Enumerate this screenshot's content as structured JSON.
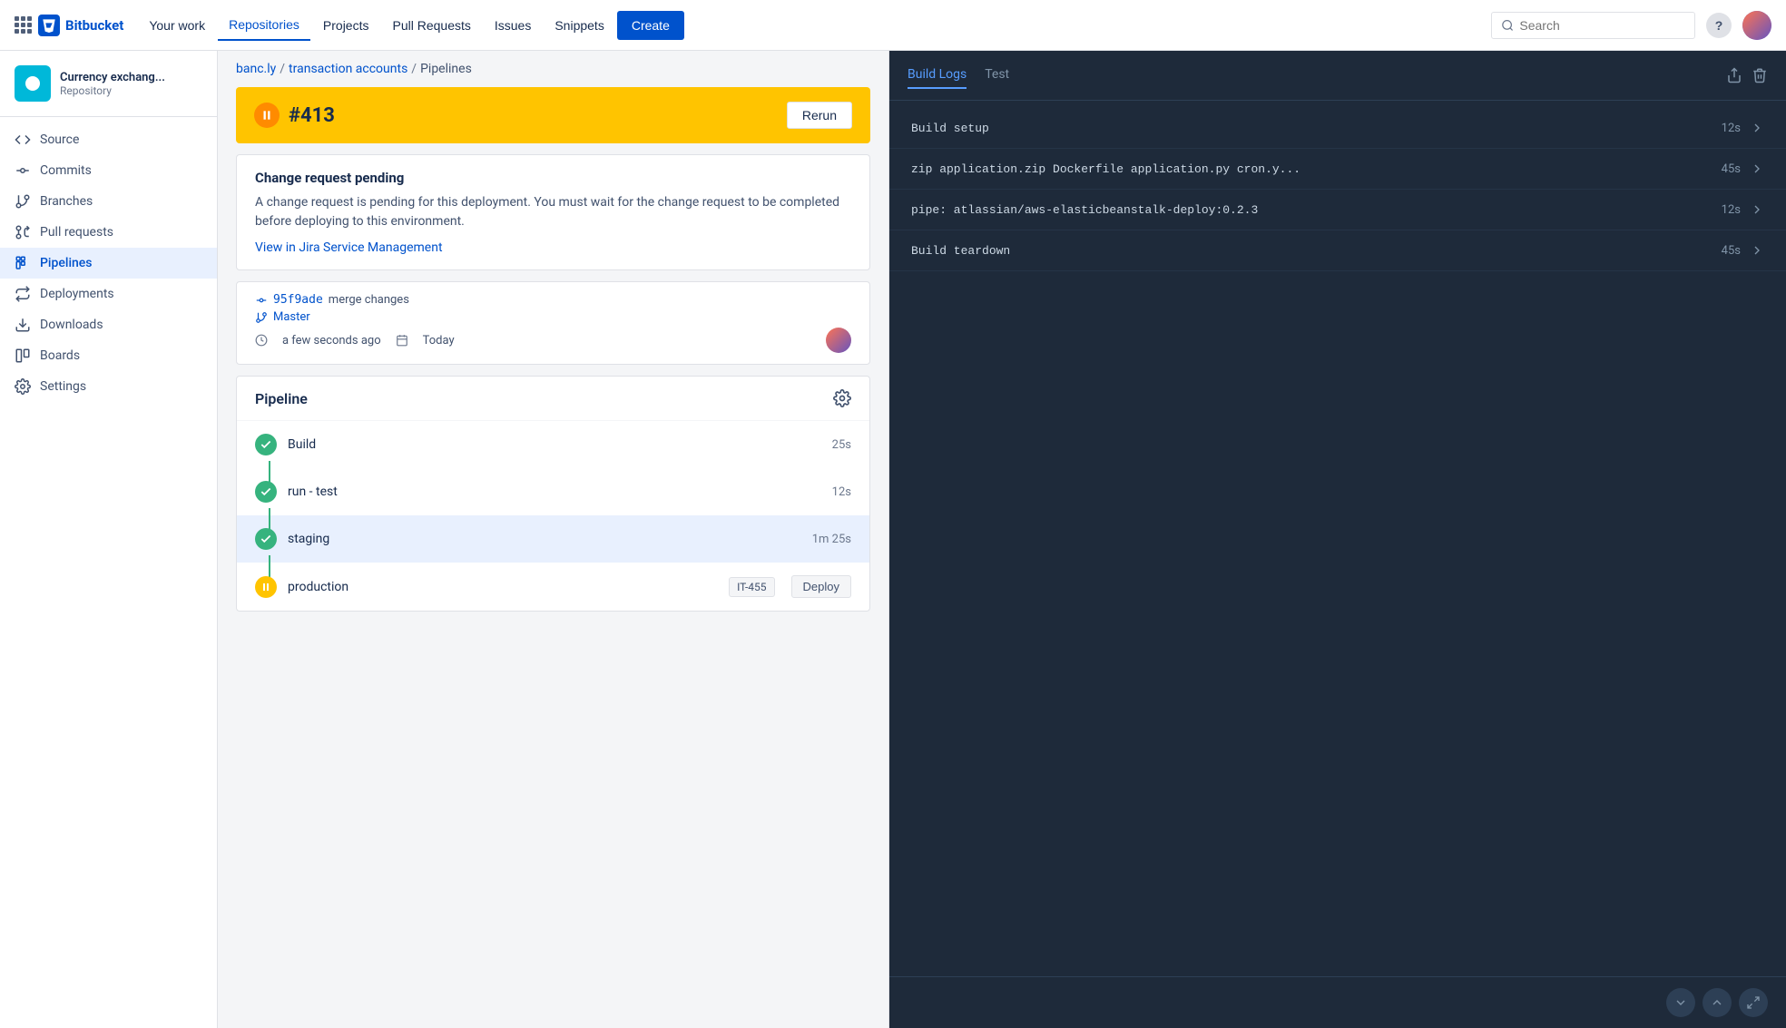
{
  "topnav": {
    "app_name": "Bitbucket",
    "links": [
      {
        "label": "Your work",
        "active": false
      },
      {
        "label": "Repositories",
        "active": true
      },
      {
        "label": "Projects",
        "active": false
      },
      {
        "label": "Pull Requests",
        "active": false
      },
      {
        "label": "Issues",
        "active": false
      },
      {
        "label": "Snippets",
        "active": false
      }
    ],
    "create_label": "Create",
    "search_placeholder": "Search",
    "help_label": "?"
  },
  "sidebar": {
    "repo_name": "Currency exchang...",
    "repo_type": "Repository",
    "nav_items": [
      {
        "label": "Source",
        "icon": "source"
      },
      {
        "label": "Commits",
        "icon": "commits"
      },
      {
        "label": "Branches",
        "icon": "branches"
      },
      {
        "label": "Pull requests",
        "icon": "pull-requests"
      },
      {
        "label": "Pipelines",
        "icon": "pipelines",
        "active": true
      },
      {
        "label": "Deployments",
        "icon": "deployments"
      },
      {
        "label": "Downloads",
        "icon": "downloads"
      },
      {
        "label": "Boards",
        "icon": "boards"
      },
      {
        "label": "Settings",
        "icon": "settings"
      }
    ]
  },
  "breadcrumb": {
    "parts": [
      "banc.ly",
      "transaction accounts",
      "Pipelines"
    ],
    "separators": [
      "/",
      "/"
    ]
  },
  "pipeline": {
    "number": "#413",
    "status": "paused",
    "rerun_label": "Rerun",
    "change_request": {
      "title": "Change request pending",
      "description": "A change request is pending for this deployment. You must wait for the change request to be completed before deploying to this environment.",
      "link_label": "View in Jira Service Management"
    },
    "commit": {
      "hash": "95f9ade",
      "message": "merge changes",
      "branch": "Master",
      "time": "a few seconds ago",
      "date": "Today"
    },
    "steps_title": "Pipeline",
    "steps": [
      {
        "name": "Build",
        "status": "success",
        "duration": "25s"
      },
      {
        "name": "run - test",
        "status": "success",
        "duration": "12s"
      },
      {
        "name": "staging",
        "status": "success",
        "duration": "1m 25s",
        "active": true
      },
      {
        "name": "production",
        "status": "paused",
        "badge": "IT-455",
        "deploy_label": "Deploy"
      }
    ]
  },
  "build_logs": {
    "tabs": [
      {
        "label": "Build Logs",
        "active": true
      },
      {
        "label": "Test",
        "active": false
      }
    ],
    "entries": [
      {
        "name": "Build setup",
        "duration": "12s"
      },
      {
        "name": "zip application.zip Dockerfile application.py cron.y...",
        "duration": "45s"
      },
      {
        "name": "pipe: atlassian/aws-elasticbeanstalk-deploy:0.2.3",
        "duration": "12s"
      },
      {
        "name": "Build teardown",
        "duration": "45s"
      }
    ]
  }
}
